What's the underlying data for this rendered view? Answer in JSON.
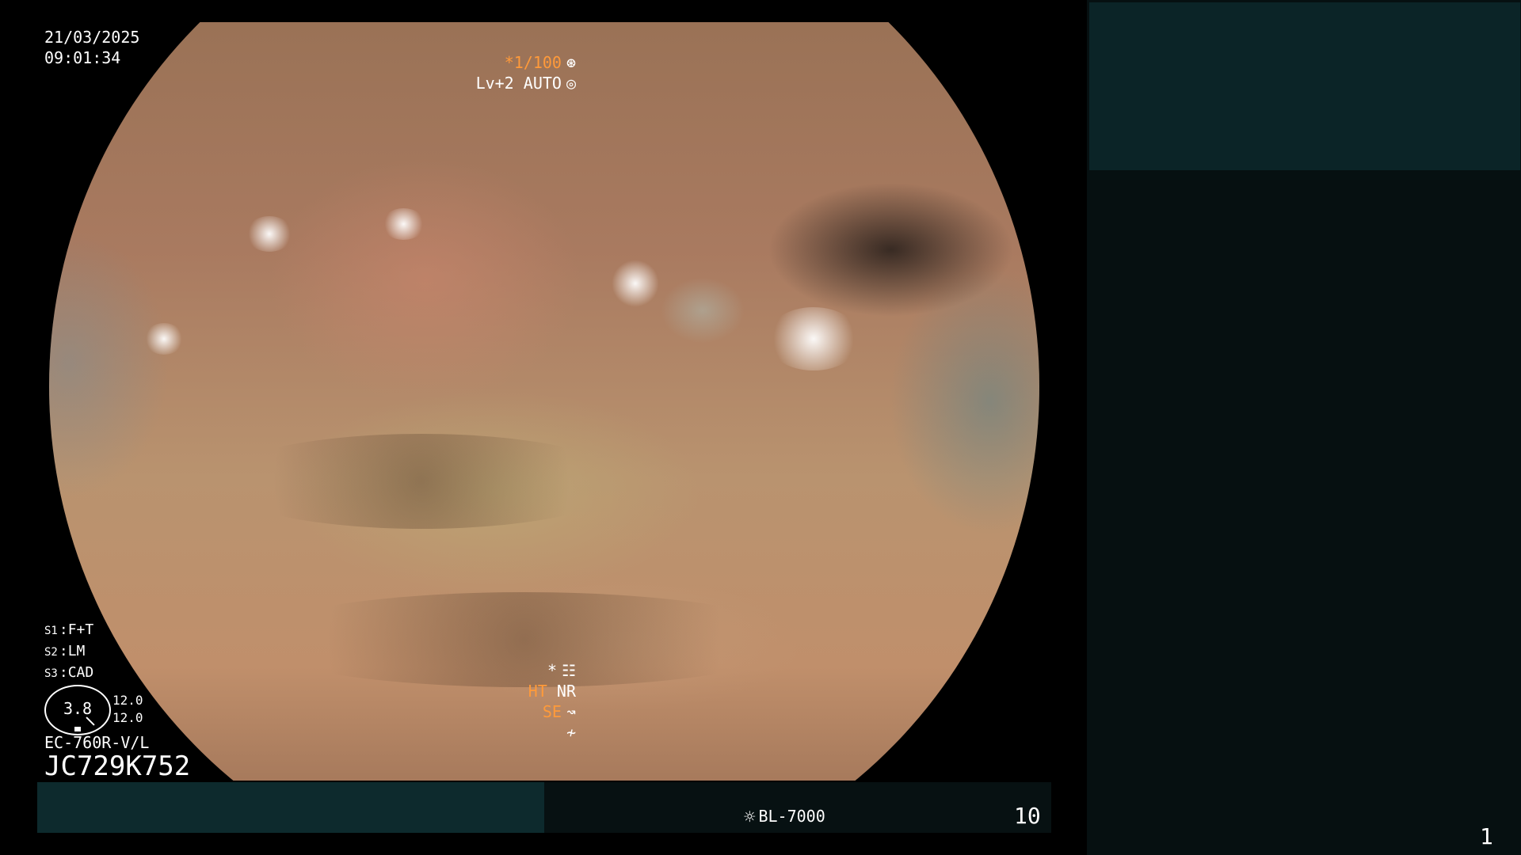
{
  "overlay": {
    "date": "21/03/2025",
    "time": "09:01:34",
    "shutter": "*1/100",
    "light_level": "Lv+2",
    "light_mode": "AUTO",
    "settings": [
      {
        "key": "S1",
        "value": "F+T"
      },
      {
        "key": "S2",
        "value": "LM"
      },
      {
        "key": "S3",
        "value": "CAD"
      }
    ],
    "dial_value": "3.8",
    "dial_side_top": "12.0",
    "dial_side_bottom": "12.0",
    "scope_model": "EC-760R-V/L",
    "scope_serial": "JC729K752",
    "right_indicators": {
      "star": "*",
      "ht": "HT",
      "nr": "NR",
      "se": "SE"
    }
  },
  "status_bar": {
    "light_source": "BL-7000",
    "frame_count": "10"
  },
  "page": {
    "number": "1"
  },
  "colors": {
    "accent_orange": "#ff9a3a",
    "status_bar_left": "#0d2a2d",
    "status_bar_right": "#071112",
    "right_panel": "#061011",
    "right_panel_top": "#0b2427"
  },
  "icons": {
    "shutter": "shutter-icon",
    "auto": "auto-exposure-icon",
    "sheet": "settings-sheet-icon",
    "se": "structure-enhance-icon",
    "light": "sun-icon"
  }
}
